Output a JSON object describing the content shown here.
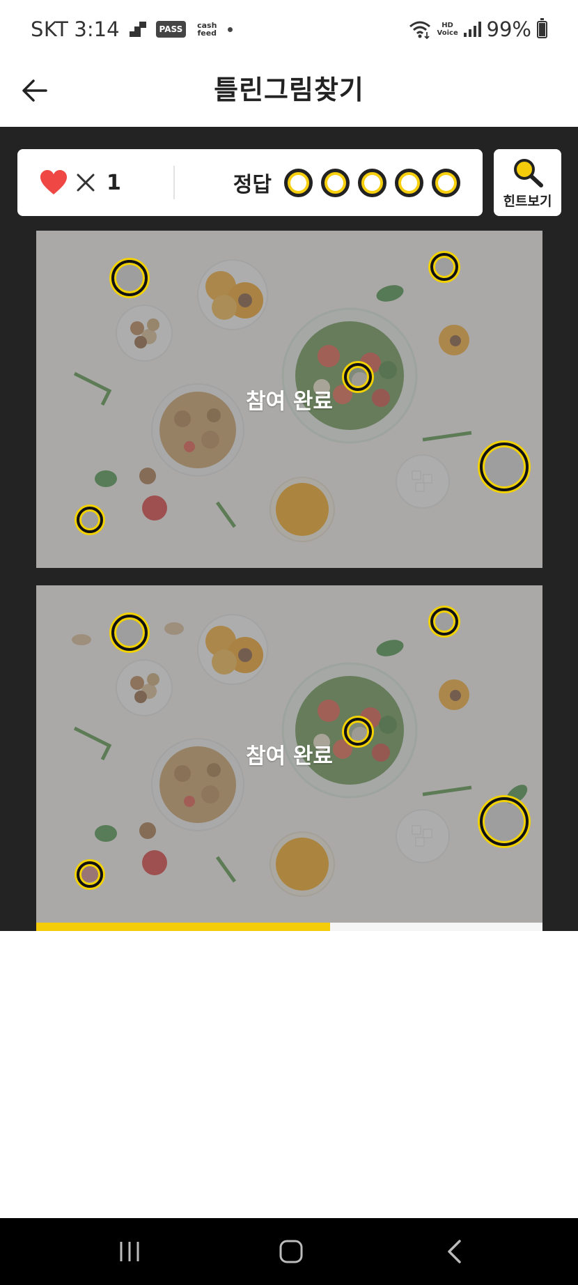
{
  "status_bar": {
    "carrier": "SKT",
    "time": "3:14",
    "pass_badge": "PASS",
    "cash_feed": "cash feed",
    "hd_voice": "HD Voice",
    "battery": "99%"
  },
  "header": {
    "title": "틀린그림찾기"
  },
  "score": {
    "lives_prefix": "×",
    "lives_count": "1",
    "answers_label": "정답",
    "answers_total": 5,
    "answers_found": 0
  },
  "hint": {
    "label": "힌트보기"
  },
  "pictures": {
    "top_overlay": "참여 완료",
    "bottom_overlay": "참여 완료"
  },
  "progress": {
    "fraction": 0.58
  },
  "colors": {
    "accent_yellow": "#f4cc0a",
    "heart_red": "#ef4744",
    "game_bg": "#232323"
  },
  "icons": {
    "back": "arrow-left-icon",
    "lives": "heart-icon",
    "hint": "magnifier-icon",
    "nav_recent": "recent-apps-icon",
    "nav_home": "home-icon",
    "nav_back": "chevron-left-icon"
  }
}
